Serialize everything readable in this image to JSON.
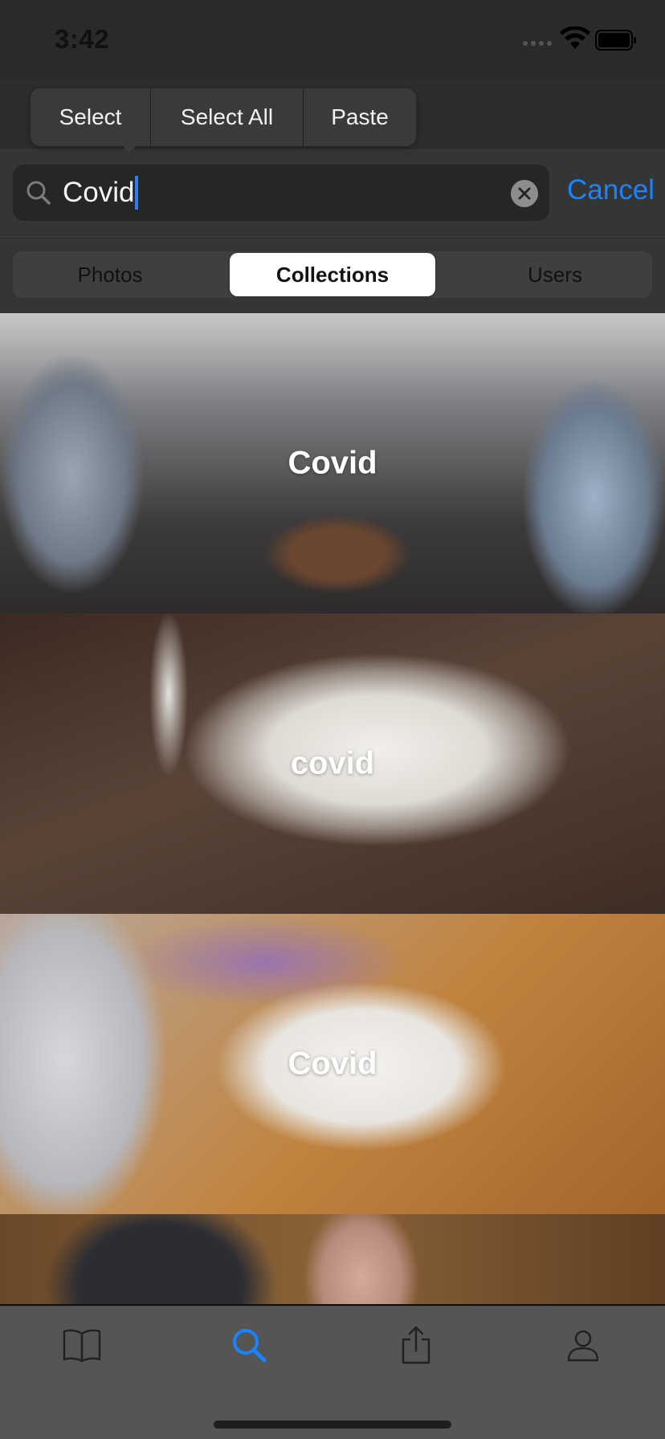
{
  "status_bar": {
    "time": "3:42"
  },
  "edit_menu": {
    "items": [
      "Select",
      "Select All",
      "Paste"
    ]
  },
  "search": {
    "query": "Covid",
    "cancel_label": "Cancel"
  },
  "segmented_control": {
    "segments": [
      "Photos",
      "Collections",
      "Users"
    ],
    "selected": "Collections"
  },
  "collections": [
    {
      "title": "Covid"
    },
    {
      "title": "covid"
    },
    {
      "title": "Covid"
    },
    {
      "title": ""
    }
  ],
  "tab_bar": {
    "tabs": [
      {
        "icon": "book-icon",
        "active": false
      },
      {
        "icon": "search-icon",
        "active": true
      },
      {
        "icon": "share-icon",
        "active": false
      },
      {
        "icon": "person-icon",
        "active": false
      }
    ]
  },
  "colors": {
    "accent": "#1a84ff",
    "background": "#2b2b2d",
    "tab_bar": "#555555"
  }
}
